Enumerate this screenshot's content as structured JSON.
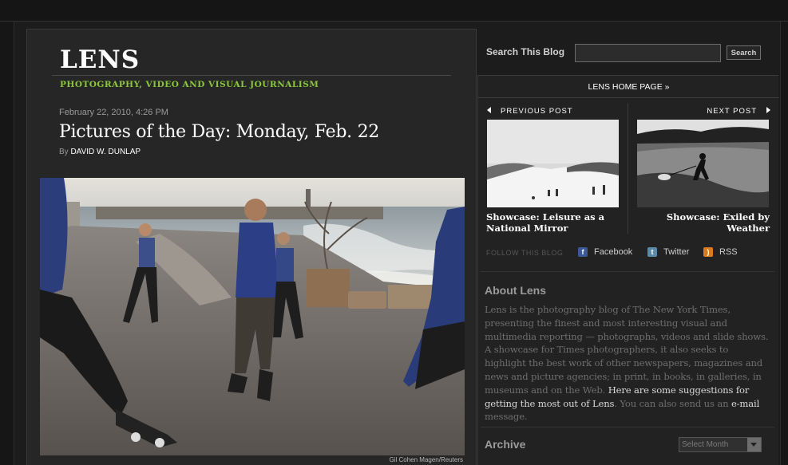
{
  "blog": {
    "logo": "LENS",
    "tagline": "PHOTOGRAPHY, VIDEO AND VISUAL JOURNALISM"
  },
  "post": {
    "date": "February 22, 2010, 4:26 PM",
    "title": "Pictures of the Day: Monday, Feb. 22",
    "byline_prefix": "By",
    "author": "DAVID W. DUNLAP",
    "photo_credit": "Gil Cohen Magen/Reuters"
  },
  "search": {
    "label": "Search This Blog",
    "value": "",
    "button_label": "Search"
  },
  "sidebar": {
    "home_link": "LENS HOME PAGE »",
    "previous_label": "PREVIOUS POST",
    "next_label": "NEXT POST",
    "previous_title": "Showcase: Leisure as a National Mirror",
    "next_title": "Showcase: Exiled by Weather",
    "follow_label": "FOLLOW THIS BLOG",
    "social": [
      {
        "label": "Facebook",
        "icon": "facebook-icon",
        "color": "#3b5998"
      },
      {
        "label": "Twitter",
        "icon": "twitter-icon",
        "color": "#5b8aa8"
      },
      {
        "label": "RSS",
        "icon": "rss-icon",
        "color": "#d97a1c"
      }
    ],
    "about_heading": "About Lens",
    "about_text_1": "Lens is the photography blog of The New York Times, presenting the finest and most interesting visual and multimedia reporting — photographs, videos and slide shows. A showcase for Times photographers, it also seeks to highlight the best work of other newspapers, magazines and news and picture agencies; in print, in books, in galleries, in museums and on the Web. ",
    "about_link_1": "Here are some suggestions for getting the most out of Lens",
    "about_text_2": ". You can also send us an ",
    "about_link_2": "e-mail",
    "about_text_3": " message.",
    "archive_heading": "Archive",
    "archive_select": "Select Month"
  },
  "colors": {
    "accent_green": "#8cc63f",
    "background": "#1c1c1c",
    "panel": "#262626"
  }
}
